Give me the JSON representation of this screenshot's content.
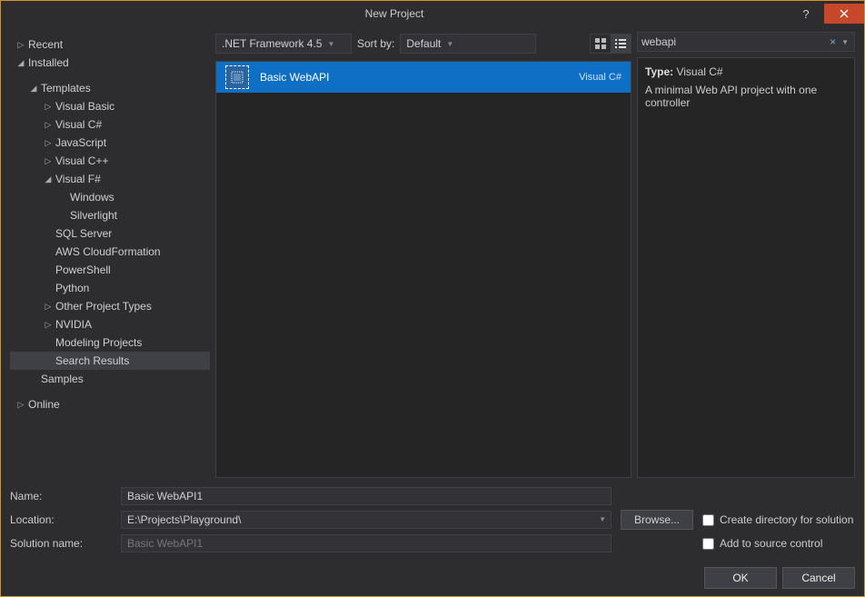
{
  "window": {
    "title": "New Project"
  },
  "sidebar": {
    "nodes": [
      {
        "label": "Recent",
        "indent": 0,
        "caret": "right"
      },
      {
        "label": "Installed",
        "indent": 0,
        "caret": "down"
      },
      {
        "label": "Templates",
        "indent": 1,
        "caret": "down"
      },
      {
        "label": "Visual Basic",
        "indent": 2,
        "caret": "right"
      },
      {
        "label": "Visual C#",
        "indent": 2,
        "caret": "right"
      },
      {
        "label": "JavaScript",
        "indent": 2,
        "caret": "right"
      },
      {
        "label": "Visual C++",
        "indent": 2,
        "caret": "right"
      },
      {
        "label": "Visual F#",
        "indent": 2,
        "caret": "down"
      },
      {
        "label": "Windows",
        "indent": 3,
        "caret": ""
      },
      {
        "label": "Silverlight",
        "indent": 3,
        "caret": ""
      },
      {
        "label": "SQL Server",
        "indent": 2,
        "caret": ""
      },
      {
        "label": "AWS CloudFormation",
        "indent": 2,
        "caret": ""
      },
      {
        "label": "PowerShell",
        "indent": 2,
        "caret": ""
      },
      {
        "label": "Python",
        "indent": 2,
        "caret": ""
      },
      {
        "label": "Other Project Types",
        "indent": 2,
        "caret": "right"
      },
      {
        "label": "NVIDIA",
        "indent": 2,
        "caret": "right"
      },
      {
        "label": "Modeling Projects",
        "indent": 2,
        "caret": ""
      },
      {
        "label": "Search Results",
        "indent": 2,
        "caret": "",
        "selected": true
      },
      {
        "label": "Samples",
        "indent": 1,
        "caret": ""
      },
      {
        "label": "Online",
        "indent": 0,
        "caret": "right"
      }
    ]
  },
  "toolbar": {
    "framework": ".NET Framework 4.5",
    "sortby_label": "Sort by:",
    "sortby_value": "Default"
  },
  "templates": [
    {
      "name": "Basic WebAPI",
      "language": "Visual C#",
      "selected": true
    }
  ],
  "search": {
    "value": "webapi"
  },
  "details": {
    "type_label": "Type:",
    "type_value": "Visual C#",
    "description": "A minimal Web API project with one controller"
  },
  "form": {
    "name_label": "Name:",
    "name_value": "Basic WebAPI1",
    "location_label": "Location:",
    "location_value": "E:\\Projects\\Playground\\",
    "browse_label": "Browse...",
    "solution_label": "Solution name:",
    "solution_value": "Basic WebAPI1",
    "check_createdir": "Create directory for solution",
    "check_sourcecontrol": "Add to source control"
  },
  "footer": {
    "ok": "OK",
    "cancel": "Cancel"
  }
}
